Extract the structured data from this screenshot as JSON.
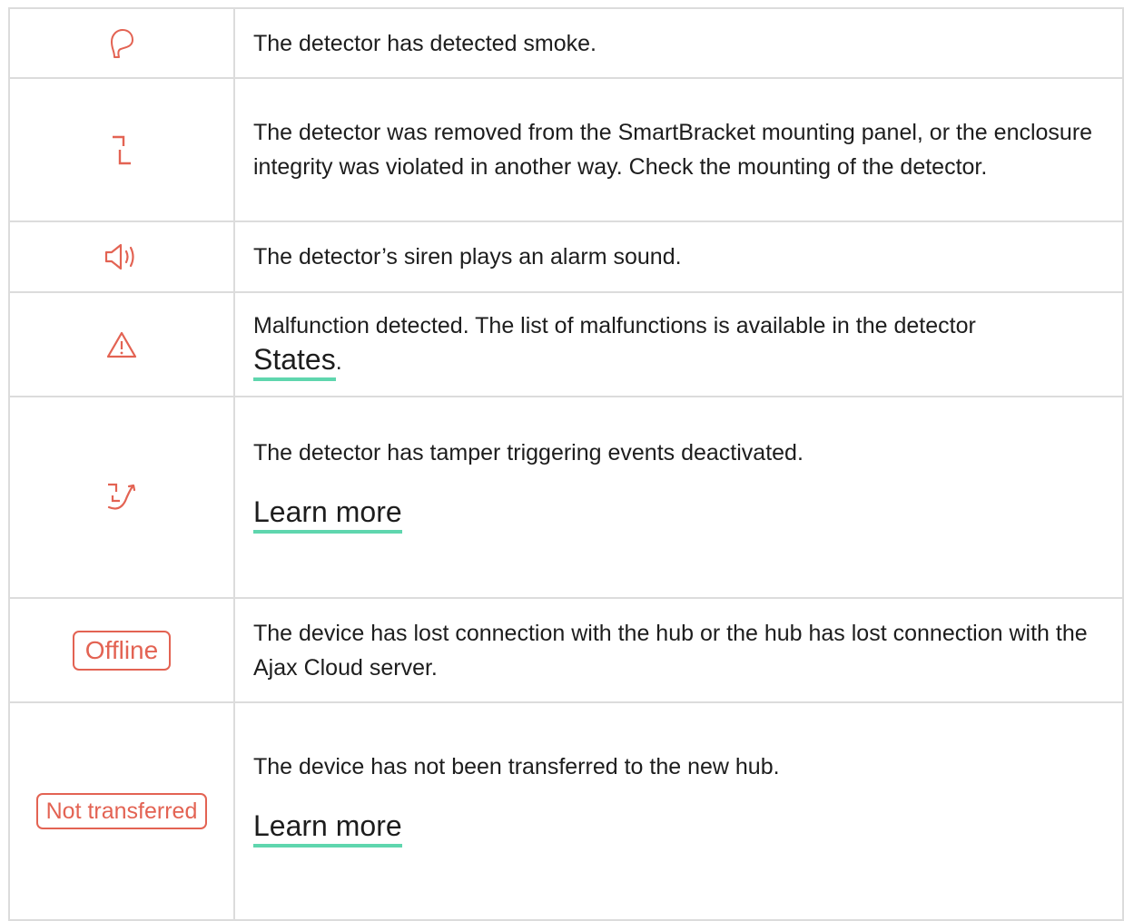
{
  "rows": [
    {
      "icon": "smoke-icon",
      "text": "The detector has detected smoke."
    },
    {
      "icon": "tamper-icon",
      "text": "The detector was removed from the SmartBracket mounting panel, or the enclosure integrity was violated in another way. Check the mounting of the detector."
    },
    {
      "icon": "siren-speaker-icon",
      "text": "The detector’s siren plays an alarm sound."
    },
    {
      "icon": "warning-triangle-icon",
      "text": "Malfunction detected. The list of malfunctions is available in the detector",
      "link": "States",
      "suffix": "."
    },
    {
      "icon": "tamper-deactivated-icon",
      "text": "The detector has tamper triggering events deactivated.",
      "link": "Learn more"
    },
    {
      "badge": "Offline",
      "text": "The device has lost connection with the hub or the hub has lost connection with the Ajax Cloud server."
    },
    {
      "badge": "Not transferred",
      "text": "The device has not been transferred to the new hub.",
      "link": "Learn more"
    }
  ],
  "colors": {
    "accent": "#e36353",
    "link_underline": "#5fd6ae",
    "border": "#dcdcdc"
  }
}
